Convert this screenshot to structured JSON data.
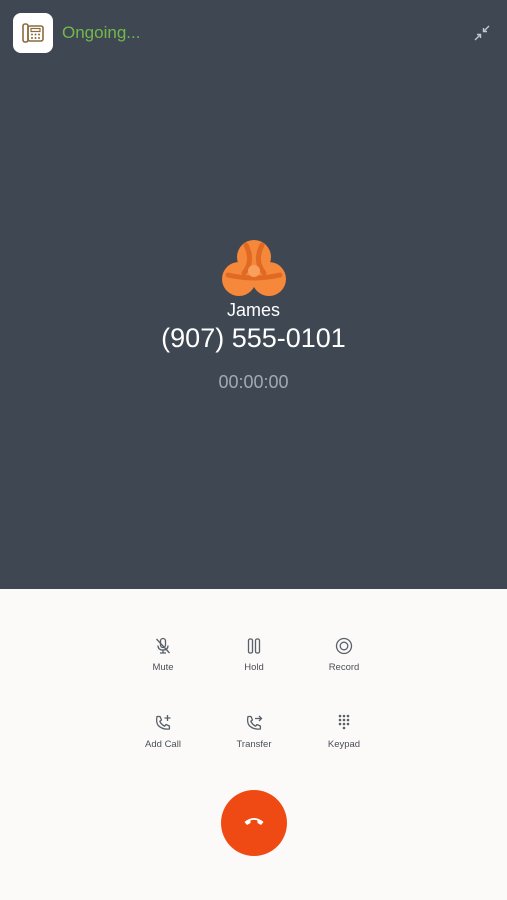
{
  "header": {
    "status": "Ongoing...",
    "app_icon": "desk-phone-icon",
    "minimize_icon": "collapse-arrows-icon"
  },
  "call": {
    "name": "James",
    "number": "(907) 555-0101",
    "timer": "00:00:00",
    "avatar_icon": "orange-tri-orb-avatar"
  },
  "controls": [
    {
      "label": "Mute",
      "icon": "mic-off-icon"
    },
    {
      "label": "Hold",
      "icon": "pause-icon"
    },
    {
      "label": "Record",
      "icon": "record-icon"
    },
    {
      "label": "Add Call",
      "icon": "phone-plus-icon"
    },
    {
      "label": "Transfer",
      "icon": "phone-forward-icon"
    },
    {
      "label": "Keypad",
      "icon": "dialpad-icon"
    }
  ],
  "hangup": {
    "icon": "phone-hangup-icon"
  },
  "colors": {
    "top_bg": "#3f4753",
    "bottom_bg": "#fbfaf8",
    "status_green": "#72b94a",
    "hangup_red": "#f04a14",
    "avatar_orange": "#f5883a"
  }
}
